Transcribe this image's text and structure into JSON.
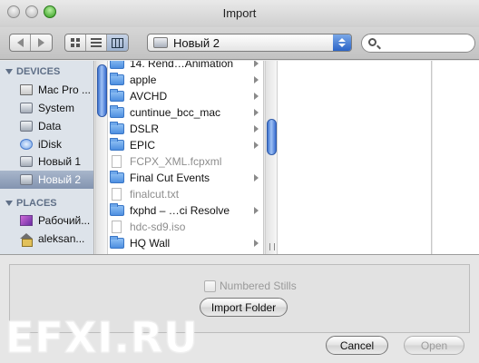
{
  "window": {
    "title": "Import"
  },
  "toolbar": {
    "location": "Новый 2",
    "search": {
      "value": "",
      "placeholder": ""
    }
  },
  "sidebar": {
    "devices_header": "DEVICES",
    "places_header": "PLACES",
    "devices": [
      {
        "label": "Mac Pro ...",
        "icon": "computer-icon"
      },
      {
        "label": "System",
        "icon": "drive-icon"
      },
      {
        "label": "Data",
        "icon": "drive-icon"
      },
      {
        "label": "iDisk",
        "icon": "idisk-icon"
      },
      {
        "label": "Новый 1",
        "icon": "drive-icon"
      },
      {
        "label": "Новый 2",
        "icon": "drive-icon",
        "selected": true
      }
    ],
    "places": [
      {
        "label": "Рабочий...",
        "icon": "desktop-icon"
      },
      {
        "label": "aleksan...",
        "icon": "home-icon"
      }
    ]
  },
  "browser": {
    "items": [
      {
        "name": "14. Rend…Animation",
        "kind": "folder",
        "enabled": true,
        "has_children": true
      },
      {
        "name": "apple",
        "kind": "folder",
        "enabled": true,
        "has_children": true
      },
      {
        "name": "AVCHD",
        "kind": "folder",
        "enabled": true,
        "has_children": true
      },
      {
        "name": "cuntinue_bcc_mac",
        "kind": "folder",
        "enabled": true,
        "has_children": true
      },
      {
        "name": "DSLR",
        "kind": "folder",
        "enabled": true,
        "has_children": true
      },
      {
        "name": "EPIC",
        "kind": "folder",
        "enabled": true,
        "has_children": true
      },
      {
        "name": "FCPX_XML.fcpxml",
        "kind": "file",
        "enabled": false,
        "has_children": false
      },
      {
        "name": "Final Cut Events",
        "kind": "folder",
        "enabled": true,
        "has_children": true
      },
      {
        "name": "finalcut.txt",
        "kind": "file",
        "enabled": false,
        "has_children": false
      },
      {
        "name": "fxphd – …ci Resolve",
        "kind": "folder",
        "enabled": true,
        "has_children": true
      },
      {
        "name": "hdc-sd9.iso",
        "kind": "file",
        "enabled": false,
        "has_children": false
      },
      {
        "name": "HQ Wall",
        "kind": "folder",
        "enabled": true,
        "has_children": true
      }
    ]
  },
  "options": {
    "numbered_stills": "Numbered Stills",
    "numbered_stills_checked": false,
    "import_folder": "Import Folder"
  },
  "actions": {
    "cancel": "Cancel",
    "open": "Open"
  },
  "watermark": "EFXI.RU",
  "colors": {
    "selection": "#8394b0",
    "zoom_button": "#2f9a1b",
    "scroll_thumb": "#3d72cf"
  }
}
